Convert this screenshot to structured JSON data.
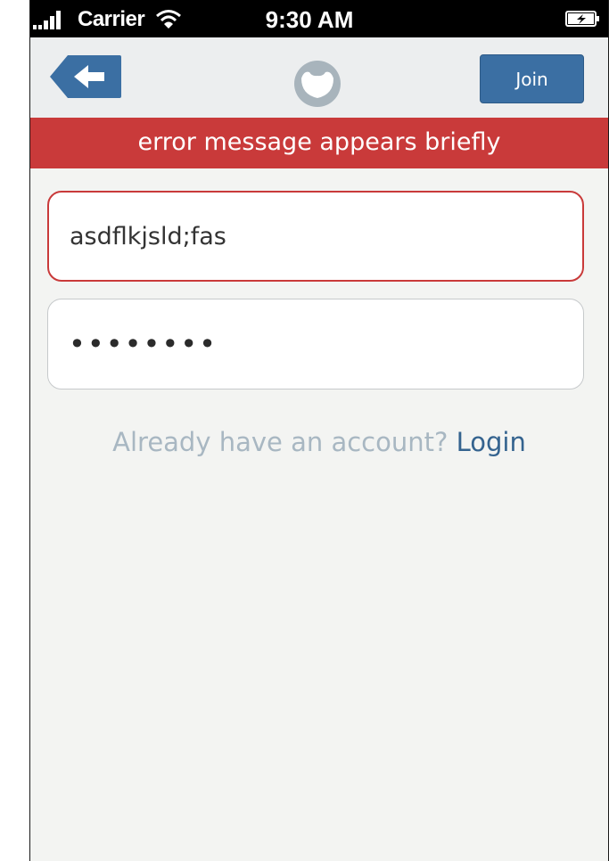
{
  "status_bar": {
    "carrier": "Carrier",
    "time": "9:30 AM",
    "icons": [
      "signal-bars-icon",
      "wifi-icon",
      "battery-charging-icon"
    ]
  },
  "nav_bar": {
    "back_icon": "arrow-left-icon",
    "logo_icon": "app-logo-icon",
    "join_label": "Join"
  },
  "error_banner": {
    "text": "error message appears briefly"
  },
  "form": {
    "username_value": "asdflkjsld;fas",
    "password_value": "••••••••"
  },
  "login_prompt": {
    "question": "Already have an account?",
    "link": "Login"
  },
  "colors": {
    "error": "#c93a3a",
    "accent": "#3b6fa3",
    "link": "#34638f",
    "muted_text": "#a8b7c2",
    "background": "#f3f4f2"
  }
}
